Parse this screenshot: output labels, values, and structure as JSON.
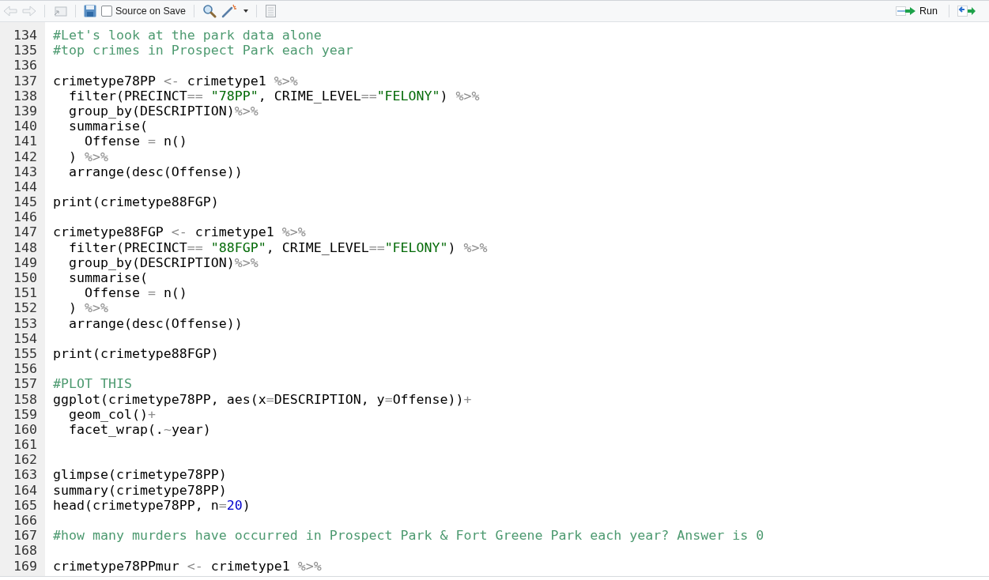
{
  "toolbar": {
    "source_on_save": {
      "label": "Source on Save",
      "checked": false
    },
    "run_button": {
      "label": "Run"
    }
  },
  "editor": {
    "lines": [
      {
        "number": "134",
        "tokens": [
          {
            "text": "#Let's look at the park data alone",
            "kind": "comment"
          }
        ]
      },
      {
        "number": "135",
        "tokens": [
          {
            "text": "#top crimes in Prospect Park each year",
            "kind": "comment"
          }
        ]
      },
      {
        "number": "136"
      },
      {
        "number": "137",
        "tokens": [
          {
            "text": "crimetype78PP ",
            "kind": "plain"
          },
          {
            "text": "<-",
            "kind": "operator"
          },
          {
            "text": " crimetype1 ",
            "kind": "plain"
          },
          {
            "text": "%>%",
            "kind": "operator"
          }
        ]
      },
      {
        "number": "138",
        "tokens": [
          {
            "text": "  filter(PRECINCT",
            "kind": "plain"
          },
          {
            "text": "==",
            "kind": "operator"
          },
          {
            "text": " \"78PP\"",
            "kind": "string"
          },
          {
            "text": ", CRIME_LEVEL",
            "kind": "plain"
          },
          {
            "text": "==",
            "kind": "operator"
          },
          {
            "text": "\"FELONY\"",
            "kind": "string"
          },
          {
            "text": ") ",
            "kind": "plain"
          },
          {
            "text": "%>%",
            "kind": "operator"
          }
        ]
      },
      {
        "number": "139",
        "tokens": [
          {
            "text": "  group_by(DESCRIPTION)",
            "kind": "plain"
          },
          {
            "text": "%>%",
            "kind": "operator"
          }
        ]
      },
      {
        "number": "140",
        "tokens": [
          {
            "text": "  summarise(",
            "kind": "plain"
          }
        ]
      },
      {
        "number": "141",
        "tokens": [
          {
            "text": "    Offense ",
            "kind": "plain"
          },
          {
            "text": "=",
            "kind": "operator"
          },
          {
            "text": " n()",
            "kind": "plain"
          }
        ]
      },
      {
        "number": "142",
        "tokens": [
          {
            "text": "  ) ",
            "kind": "plain"
          },
          {
            "text": "%>%",
            "kind": "operator"
          }
        ]
      },
      {
        "number": "143",
        "tokens": [
          {
            "text": "  arrange(desc(Offense))",
            "kind": "plain"
          }
        ]
      },
      {
        "number": "144"
      },
      {
        "number": "145",
        "tokens": [
          {
            "text": "print(crimetype88FGP)",
            "kind": "plain"
          }
        ]
      },
      {
        "number": "146"
      },
      {
        "number": "147",
        "tokens": [
          {
            "text": "crimetype88FGP ",
            "kind": "plain"
          },
          {
            "text": "<-",
            "kind": "operator"
          },
          {
            "text": " crimetype1 ",
            "kind": "plain"
          },
          {
            "text": "%>%",
            "kind": "operator"
          }
        ]
      },
      {
        "number": "148",
        "tokens": [
          {
            "text": "  filter(PRECINCT",
            "kind": "plain"
          },
          {
            "text": "==",
            "kind": "operator"
          },
          {
            "text": " \"88FGP\"",
            "kind": "string"
          },
          {
            "text": ", CRIME_LEVEL",
            "kind": "plain"
          },
          {
            "text": "==",
            "kind": "operator"
          },
          {
            "text": "\"FELONY\"",
            "kind": "string"
          },
          {
            "text": ") ",
            "kind": "plain"
          },
          {
            "text": "%>%",
            "kind": "operator"
          }
        ]
      },
      {
        "number": "149",
        "tokens": [
          {
            "text": "  group_by(DESCRIPTION)",
            "kind": "plain"
          },
          {
            "text": "%>%",
            "kind": "operator"
          }
        ]
      },
      {
        "number": "150",
        "tokens": [
          {
            "text": "  summarise(",
            "kind": "plain"
          }
        ]
      },
      {
        "number": "151",
        "tokens": [
          {
            "text": "    Offense ",
            "kind": "plain"
          },
          {
            "text": "=",
            "kind": "operator"
          },
          {
            "text": " n()",
            "kind": "plain"
          }
        ]
      },
      {
        "number": "152",
        "tokens": [
          {
            "text": "  ) ",
            "kind": "plain"
          },
          {
            "text": "%>%",
            "kind": "operator"
          }
        ]
      },
      {
        "number": "153",
        "tokens": [
          {
            "text": "  arrange(desc(Offense))",
            "kind": "plain"
          }
        ]
      },
      {
        "number": "154"
      },
      {
        "number": "155",
        "tokens": [
          {
            "text": "print(crimetype88FGP)",
            "kind": "plain"
          }
        ]
      },
      {
        "number": "156"
      },
      {
        "number": "157",
        "tokens": [
          {
            "text": "#PLOT THIS",
            "kind": "comment"
          }
        ]
      },
      {
        "number": "158",
        "tokens": [
          {
            "text": "ggplot(crimetype78PP, aes(x",
            "kind": "plain"
          },
          {
            "text": "=",
            "kind": "operator"
          },
          {
            "text": "DESCRIPTION, y",
            "kind": "plain"
          },
          {
            "text": "=",
            "kind": "operator"
          },
          {
            "text": "Offense))",
            "kind": "plain"
          },
          {
            "text": "+",
            "kind": "operator"
          }
        ]
      },
      {
        "number": "159",
        "tokens": [
          {
            "text": "  geom_col()",
            "kind": "plain"
          },
          {
            "text": "+",
            "kind": "operator"
          }
        ]
      },
      {
        "number": "160",
        "tokens": [
          {
            "text": "  facet_wrap(.",
            "kind": "plain"
          },
          {
            "text": "~",
            "kind": "operator"
          },
          {
            "text": "year)",
            "kind": "plain"
          }
        ]
      },
      {
        "number": "161"
      },
      {
        "number": "162"
      },
      {
        "number": "163",
        "tokens": [
          {
            "text": "glimpse(crimetype78PP)",
            "kind": "plain"
          }
        ]
      },
      {
        "number": "164",
        "tokens": [
          {
            "text": "summary(crimetype78PP)",
            "kind": "plain"
          }
        ]
      },
      {
        "number": "165",
        "tokens": [
          {
            "text": "head(crimetype78PP, n",
            "kind": "plain"
          },
          {
            "text": "=",
            "kind": "operator"
          },
          {
            "text": "20",
            "kind": "number"
          },
          {
            "text": ")",
            "kind": "plain"
          }
        ]
      },
      {
        "number": "166"
      },
      {
        "number": "167",
        "tokens": [
          {
            "text": "#how many murders have occurred in Prospect Park & Fort Greene Park each year? Answer is 0",
            "kind": "comment"
          }
        ]
      },
      {
        "number": "168"
      },
      {
        "number": "169",
        "tokens": [
          {
            "text": "crimetype78PPmur ",
            "kind": "plain"
          },
          {
            "text": "<-",
            "kind": "operator"
          },
          {
            "text": " crimetype1 ",
            "kind": "plain"
          },
          {
            "text": "%>%",
            "kind": "operator"
          }
        ]
      }
    ]
  }
}
